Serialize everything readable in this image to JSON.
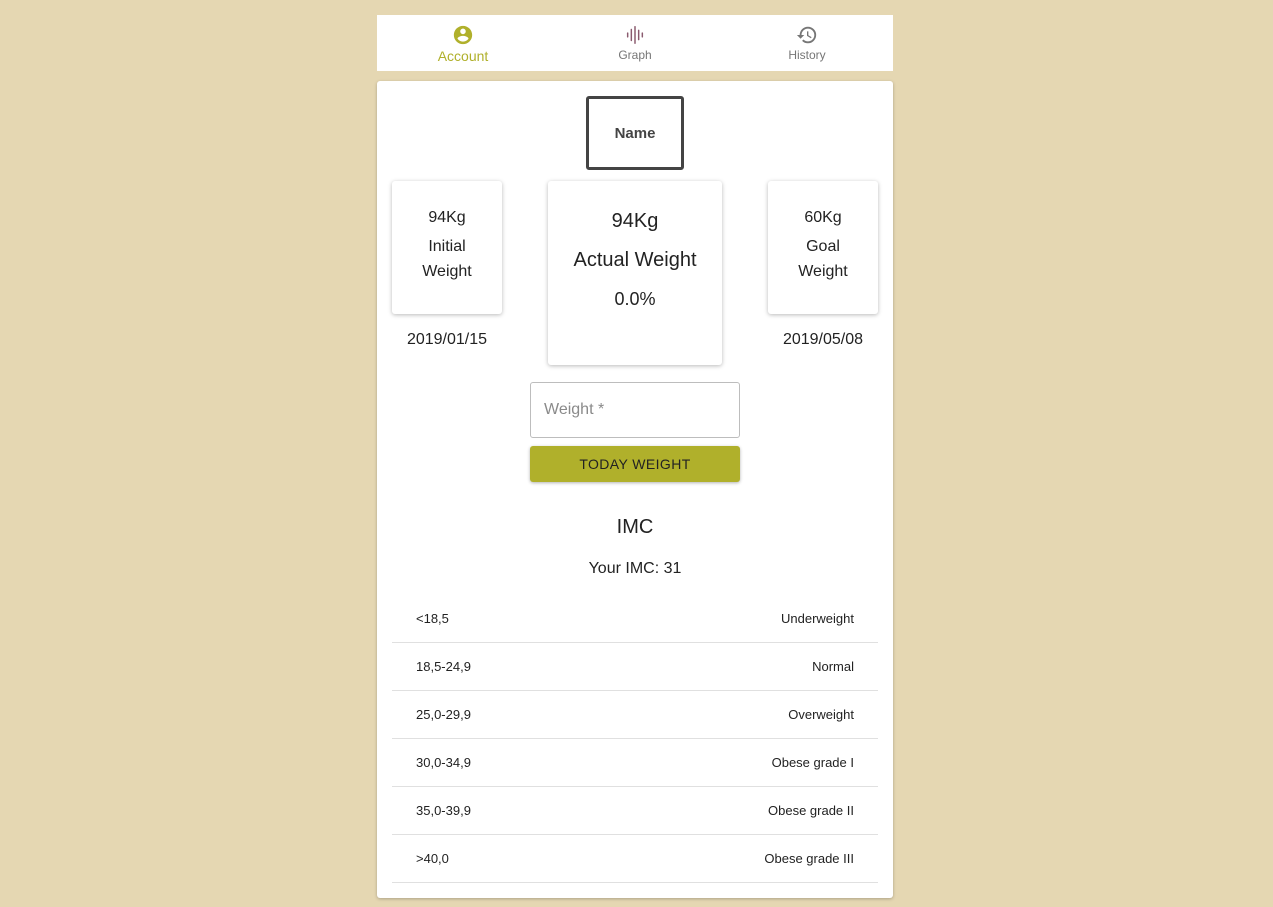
{
  "nav": {
    "tabs": [
      {
        "label": "Account",
        "icon": "account-circle-icon",
        "active": true
      },
      {
        "label": "Graph",
        "icon": "graph-icon",
        "active": false
      },
      {
        "label": "History",
        "icon": "history-icon",
        "active": false
      }
    ]
  },
  "profile": {
    "name": "Name"
  },
  "weights": {
    "initial": {
      "value": "94Kg",
      "label": "Initial Weight",
      "date": "2019/01/15"
    },
    "actual": {
      "value": "94Kg",
      "label": "Actual Weight",
      "percent": "0.0%"
    },
    "goal": {
      "value": "60Kg",
      "label": "Goal Weight",
      "date": "2019/05/08"
    }
  },
  "form": {
    "weight_placeholder": "Weight *",
    "weight_value": "",
    "submit_label": "TODAY WEIGHT"
  },
  "imc": {
    "title": "IMC",
    "your_imc": "Your IMC: 31",
    "rows": [
      {
        "range": "<18,5",
        "category": "Underweight"
      },
      {
        "range": "18,5-24,9",
        "category": "Normal"
      },
      {
        "range": "25,0-29,9",
        "category": "Overweight"
      },
      {
        "range": "30,0-34,9",
        "category": "Obese grade I"
      },
      {
        "range": "35,0-39,9",
        "category": "Obese grade II"
      },
      {
        "range": ">40,0",
        "category": "Obese grade III"
      }
    ]
  },
  "colors": {
    "background": "#e5d7b2",
    "accent": "#b0b02b",
    "graph_icon": "#8a5a6e"
  }
}
